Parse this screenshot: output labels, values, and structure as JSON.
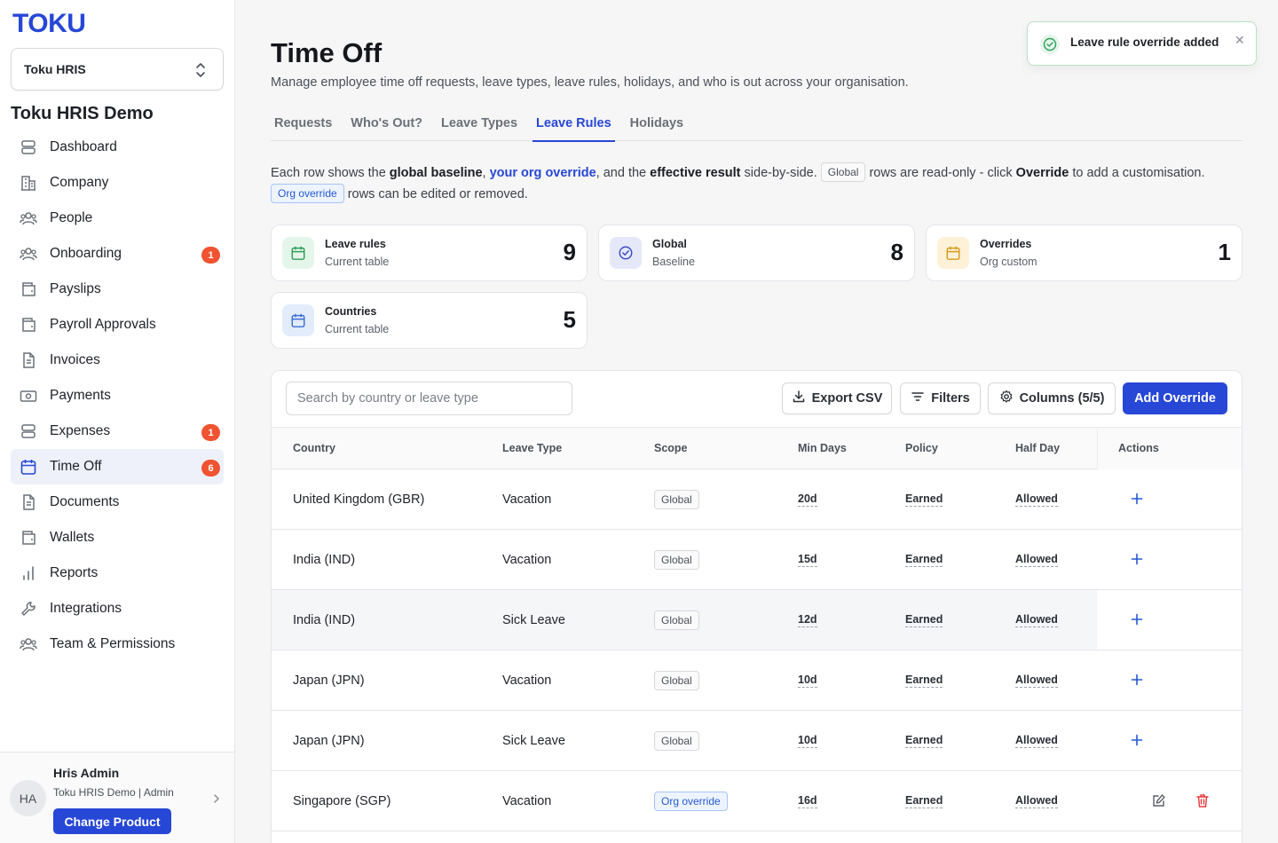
{
  "sidebar": {
    "logo": "TOKU",
    "product_select": "Toku HRIS",
    "org_name": "Toku HRIS Demo",
    "items": [
      {
        "label": "Dashboard",
        "icon": "database-icon"
      },
      {
        "label": "Company",
        "icon": "building-icon"
      },
      {
        "label": "People",
        "icon": "users-icon"
      },
      {
        "label": "Onboarding",
        "icon": "users-icon",
        "badge": "1"
      },
      {
        "label": "Payslips",
        "icon": "wallet-icon"
      },
      {
        "label": "Payroll Approvals",
        "icon": "wallet-icon"
      },
      {
        "label": "Invoices",
        "icon": "file-icon"
      },
      {
        "label": "Payments",
        "icon": "banknote-icon"
      },
      {
        "label": "Expenses",
        "icon": "database-icon",
        "badge": "1"
      },
      {
        "label": "Time Off",
        "icon": "calendar-icon",
        "badge": "6",
        "active": true
      },
      {
        "label": "Documents",
        "icon": "file-icon"
      },
      {
        "label": "Wallets",
        "icon": "wallet-icon"
      },
      {
        "label": "Reports",
        "icon": "bar-chart-icon"
      },
      {
        "label": "Integrations",
        "icon": "wrench-icon"
      },
      {
        "label": "Team & Permissions",
        "icon": "users-icon"
      }
    ],
    "user": {
      "initials": "HA",
      "name": "Hris Admin",
      "org": "Toku HRIS Demo | Admin",
      "change_product": "Change Product"
    }
  },
  "header": {
    "title": "Time Off",
    "subtitle": "Manage employee time off requests, leave types, leave rules, holidays, and who is out across your organisation."
  },
  "tabs": [
    {
      "label": "Requests"
    },
    {
      "label": "Who's Out?"
    },
    {
      "label": "Leave Types"
    },
    {
      "label": "Leave Rules",
      "active": true
    },
    {
      "label": "Holidays"
    }
  ],
  "info": {
    "t1": "Each row shows the ",
    "b1": "global baseline",
    "t2": ", ",
    "link": "your org override",
    "t3": ", and the ",
    "b2": "effective result",
    "t4": " side-by-side. ",
    "chip_global": "Global",
    "t5": " rows are read-only - click ",
    "b3": "Override",
    "t6": " to add a customisation.",
    "chip_org": "Org override",
    "t7": " rows can be edited or removed."
  },
  "stats": [
    {
      "title": "Leave rules",
      "sub": "Current table",
      "value": "9",
      "color": "#e4f6ea",
      "stroke": "#2f9e5a"
    },
    {
      "title": "Global",
      "sub": "Baseline",
      "value": "8",
      "color": "#e5e8f8",
      "stroke": "#3b4bc8"
    },
    {
      "title": "Overrides",
      "sub": "Org custom",
      "value": "1",
      "color": "#fdf1d8",
      "stroke": "#d99a1e"
    },
    {
      "title": "Countries",
      "sub": "Current table",
      "value": "5",
      "color": "#e3ecfb",
      "stroke": "#3b6fd6"
    }
  ],
  "toolbar": {
    "search_placeholder": "Search by country or leave type",
    "export": "Export CSV",
    "filters": "Filters",
    "columns": "Columns (5/5)",
    "add": "Add Override"
  },
  "table": {
    "headers": [
      "Country",
      "Leave Type",
      "Scope",
      "Min Days",
      "Policy",
      "Half Day",
      "Actions"
    ],
    "rows": [
      {
        "country": "United Kingdom (GBR)",
        "type": "Vacation",
        "scope": "Global",
        "min": "20d",
        "policy": "Earned",
        "half": "Allowed"
      },
      {
        "country": "India (IND)",
        "type": "Vacation",
        "scope": "Global",
        "min": "15d",
        "policy": "Earned",
        "half": "Allowed"
      },
      {
        "country": "India (IND)",
        "type": "Sick Leave",
        "scope": "Global",
        "min": "12d",
        "policy": "Earned",
        "half": "Allowed"
      },
      {
        "country": "Japan (JPN)",
        "type": "Vacation",
        "scope": "Global",
        "min": "10d",
        "policy": "Earned",
        "half": "Allowed"
      },
      {
        "country": "Japan (JPN)",
        "type": "Sick Leave",
        "scope": "Global",
        "min": "10d",
        "policy": "Earned",
        "half": "Allowed"
      },
      {
        "country": "Singapore (SGP)",
        "type": "Vacation",
        "scope": "Org override",
        "min": "16d",
        "policy": "Earned",
        "half": "Allowed"
      }
    ]
  },
  "toast": {
    "message": "Leave rule override added"
  }
}
